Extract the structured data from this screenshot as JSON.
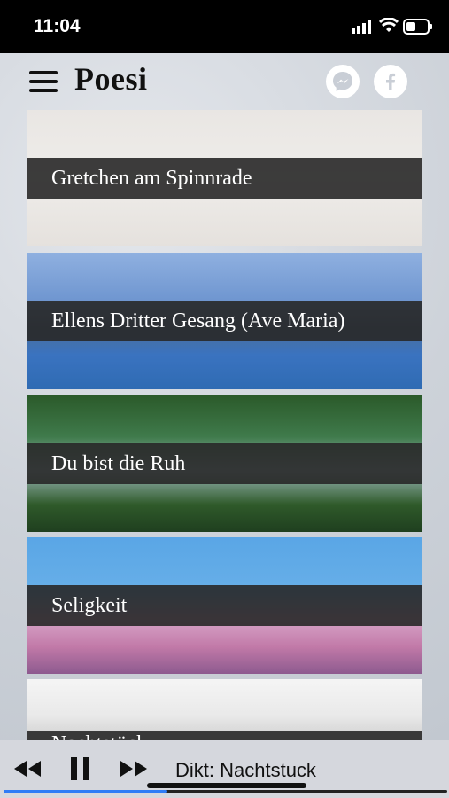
{
  "status": {
    "time": "11:04",
    "icons": [
      "signal-icon",
      "wifi-icon",
      "battery-icon"
    ]
  },
  "header": {
    "title": "Poesi",
    "menu_icon": "hamburger-menu-icon",
    "social": [
      {
        "name": "messenger-icon",
        "color": "#ffffff"
      },
      {
        "name": "facebook-icon",
        "color": "#ffffff"
      }
    ]
  },
  "poems": [
    {
      "title": "Gretchen am Spinnrade"
    },
    {
      "title": "Ellens Dritter Gesang (Ave Maria)"
    },
    {
      "title": "Du bist die Ruh"
    },
    {
      "title": "Seligkeit"
    },
    {
      "title": "Nachtstück"
    }
  ],
  "player": {
    "now_playing": "Dikt: Nachtstuck",
    "controls": [
      "rewind-icon",
      "pause-icon",
      "fast-forward-icon"
    ],
    "progress_fraction": 0.37,
    "accent_color": "#2f7cf6"
  }
}
